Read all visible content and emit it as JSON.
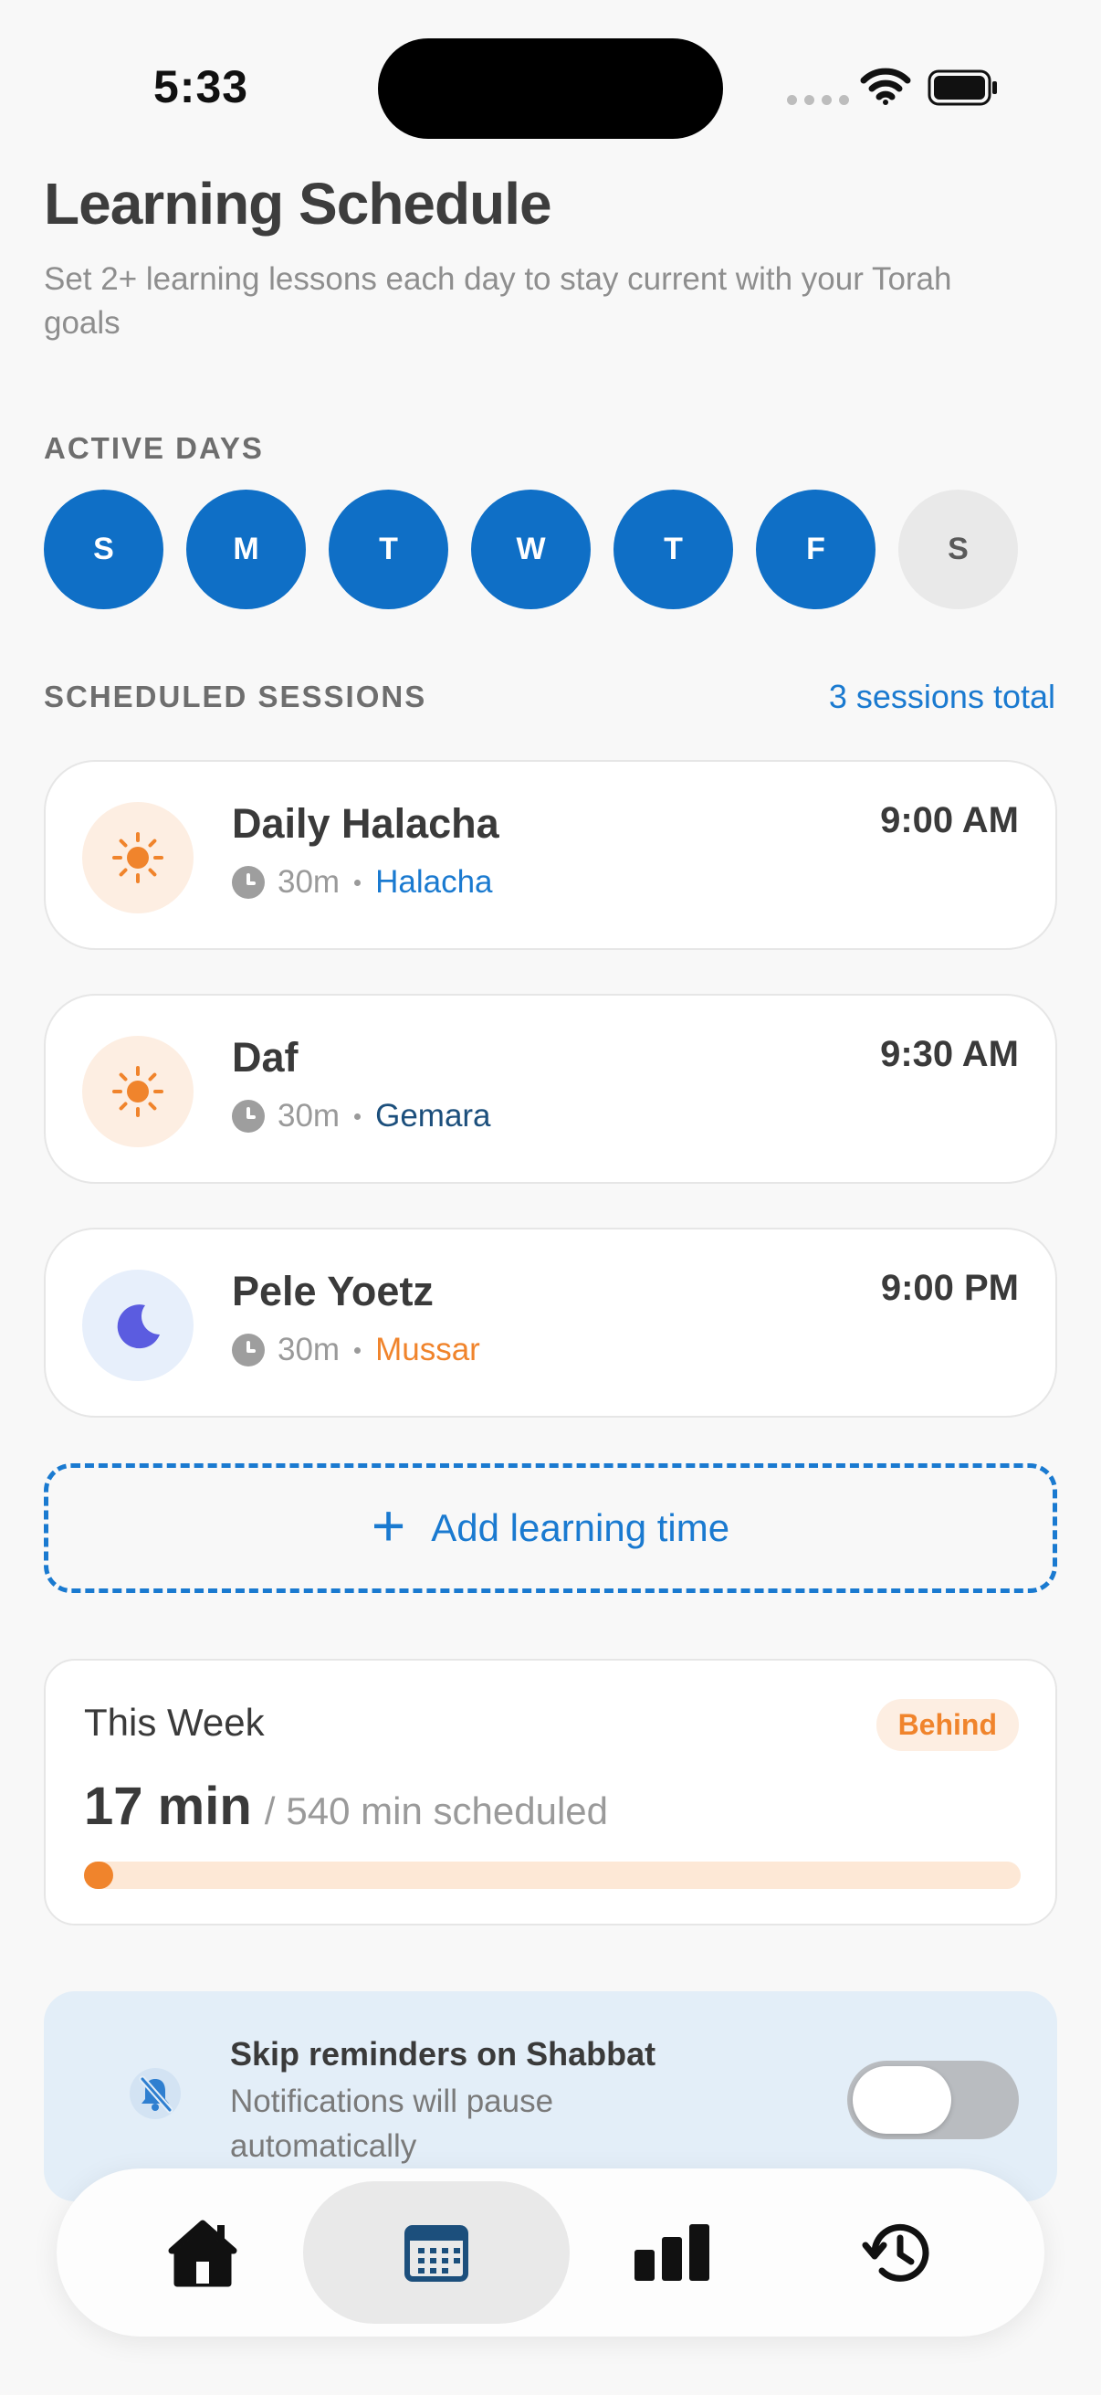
{
  "status_bar": {
    "time": "5:33"
  },
  "header": {
    "title": "Learning Schedule",
    "subtitle": "Set 2+ learning lessons each day to stay current with your Torah goals"
  },
  "active_days": {
    "label": "ACTIVE DAYS",
    "days": [
      {
        "letter": "S",
        "active": true
      },
      {
        "letter": "M",
        "active": true
      },
      {
        "letter": "T",
        "active": true
      },
      {
        "letter": "W",
        "active": true
      },
      {
        "letter": "T",
        "active": true
      },
      {
        "letter": "F",
        "active": true
      },
      {
        "letter": "S",
        "active": false
      }
    ]
  },
  "sessions": {
    "label": "SCHEDULED SESSIONS",
    "total": "3 sessions total",
    "items": [
      {
        "name": "Daily Halacha",
        "time": "9:00 AM",
        "duration": "30m",
        "category": "Halacha",
        "icon": "sun-icon"
      },
      {
        "name": "Daf",
        "time": "9:30 AM",
        "duration": "30m",
        "category": "Gemara",
        "icon": "sun-icon"
      },
      {
        "name": "Pele Yoetz",
        "time": "9:00 PM",
        "duration": "30m",
        "category": "Mussar",
        "icon": "moon-icon"
      }
    ]
  },
  "add_button": {
    "plus": "+",
    "label": "Add learning time"
  },
  "this_week": {
    "title": "This Week",
    "badge": "Behind",
    "minutes": "17 min",
    "separator": "/",
    "scheduled": "540 min scheduled",
    "progress": 0.031
  },
  "shabbat": {
    "title": "Skip reminders on Shabbat",
    "subtitle": "Notifications will pause automatically",
    "enabled": false
  },
  "tabbar": {
    "tabs": [
      {
        "icon": "home-icon",
        "active": false
      },
      {
        "icon": "calendar-icon",
        "active": true
      },
      {
        "icon": "bar-chart-icon",
        "active": false
      },
      {
        "icon": "history-icon",
        "active": false
      }
    ]
  },
  "colors": {
    "accent": "#0f6fc6",
    "link": "#1a7ad0",
    "orange": "#f0842c",
    "gemara": "#1c4f7c",
    "inactive_day": "#e9e9e9"
  }
}
